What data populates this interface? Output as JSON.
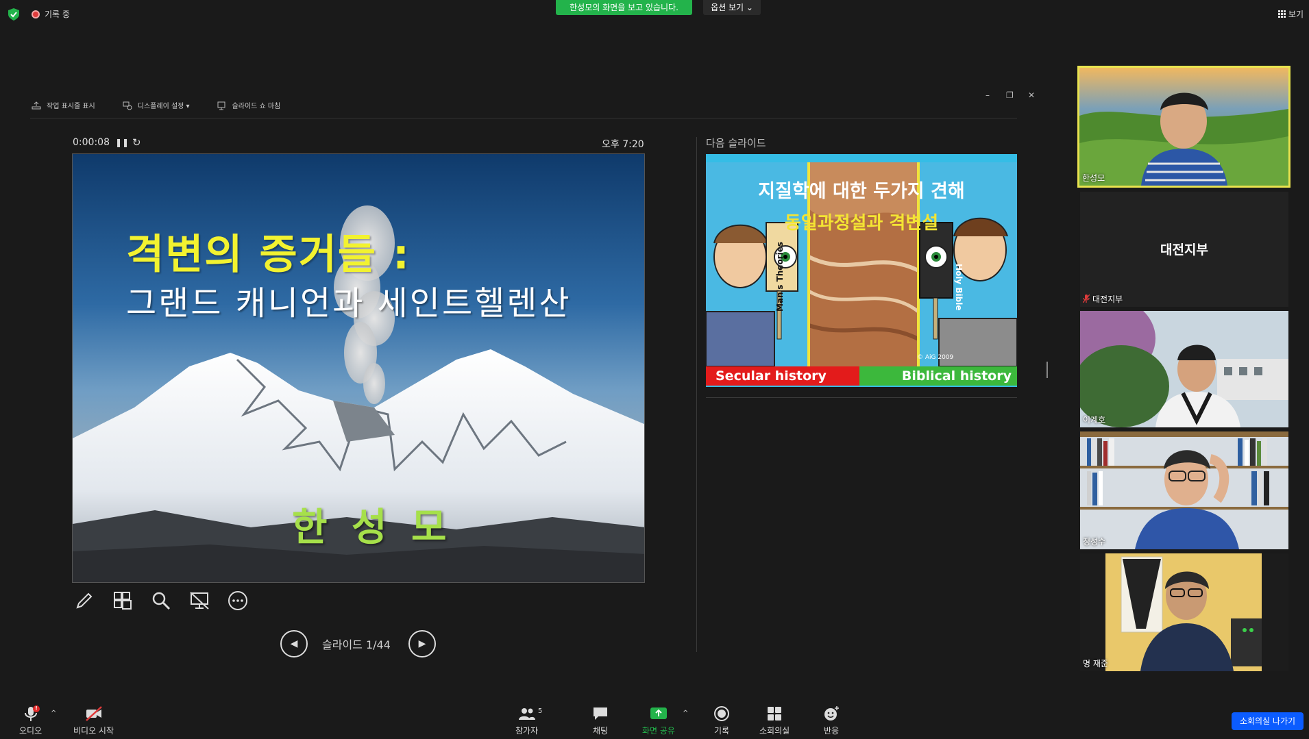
{
  "top": {
    "recording_label": "기록 중",
    "share_banner": "한성모의 화면을 보고 있습니다.",
    "view_options": "옵션 보기 ⌄",
    "view_toggle": "보기"
  },
  "presenter": {
    "toolbar": {
      "show_taskbar": "작업 표시줄 표시",
      "display_settings": "디스플레이 설정 ▾",
      "end_slideshow": "슬라이드 쇼 마침"
    },
    "timer": "0:00:08",
    "clock": "오후 7:20",
    "slide": {
      "title": "격변의 증거들 :",
      "subtitle": "그랜드 캐니언과 세인트헬렌산",
      "author": "한 성 모"
    },
    "slide_counter": "슬라이드 1/44",
    "next_slide": {
      "label": "다음 슬라이드",
      "title": "지질학에 대한 두가지 견해",
      "subtitle": "동일과정설과 격변설",
      "left_caption": "Secular history",
      "right_caption": "Biblical history",
      "copyright": "© AiG 2009",
      "theories_label": "Man's Theories",
      "bible_label": "Holy Bible"
    }
  },
  "participants": [
    {
      "name": "한성모",
      "active_speaker": true
    },
    {
      "name": "대전지부",
      "display_text": "대전지부",
      "muted": true
    },
    {
      "name": "이계호"
    },
    {
      "name": "정성수"
    },
    {
      "name": "명 재준"
    }
  ],
  "bottom": {
    "audio": "오디오",
    "audio_badge": "!",
    "video": "비디오 시작",
    "participants": "참가자",
    "participants_count": "5",
    "chat": "채팅",
    "share": "화면 공유",
    "record": "기록",
    "breakout": "소회의실",
    "reactions": "반응",
    "leave_breakout": "소회의실 나가기"
  },
  "colors": {
    "share_green": "#23b34b",
    "active_speaker_border": "#e8e24f",
    "leave_blue": "#0b5cff",
    "slide_title_yellow": "#f2f230",
    "slide_author_green": "#a6e04a"
  }
}
